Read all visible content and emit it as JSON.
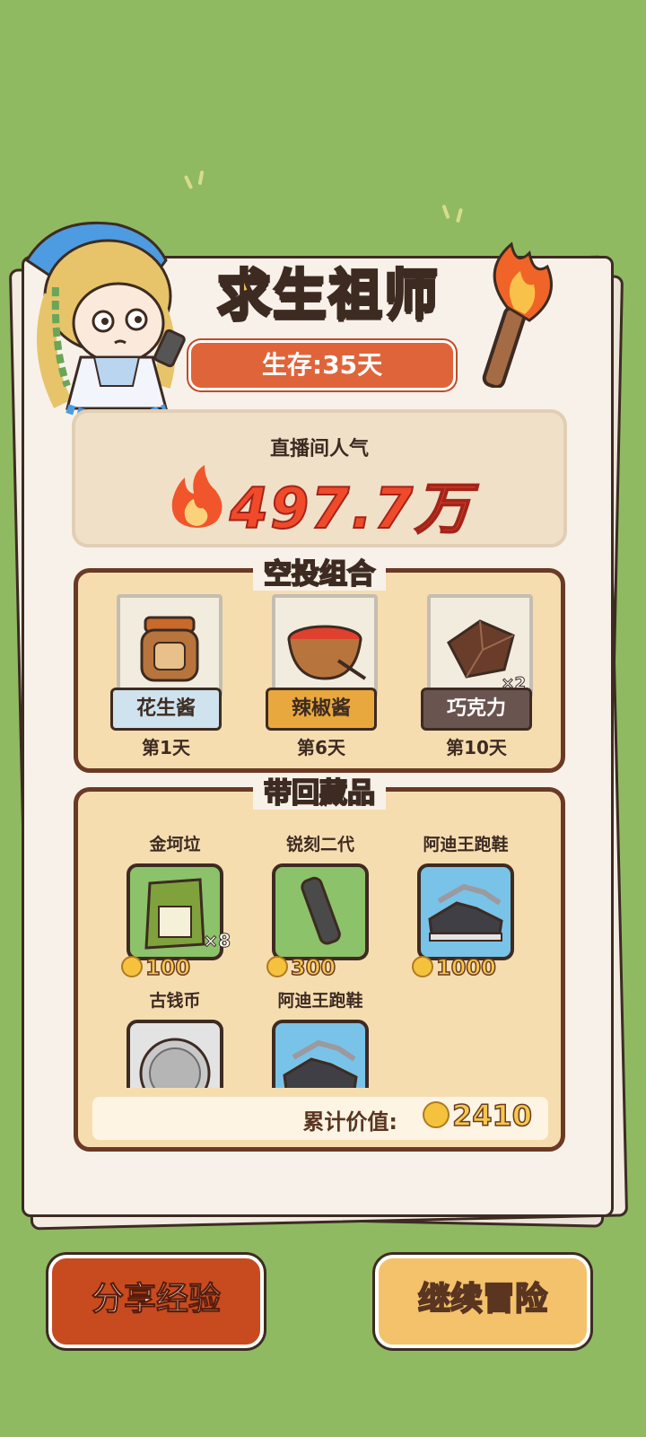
{
  "title": "求生祖师",
  "survival": "生存:35天",
  "popularity": {
    "label": "直播间人气",
    "value": "497.7万",
    "icon": "flame-icon"
  },
  "airdrop": {
    "title": "空投组合",
    "items": [
      {
        "name": "花生酱",
        "day": "第1天",
        "qty": "",
        "label_color": "#cfe3ee",
        "text_color": "#3d2b22"
      },
      {
        "name": "辣椒酱",
        "day": "第6天",
        "qty": "",
        "label_color": "#e9a83d",
        "text_color": "#3d2b22"
      },
      {
        "name": "巧克力",
        "day": "第10天",
        "qty": "×2",
        "label_color": "#6a5450",
        "text_color": "#ffffff"
      }
    ]
  },
  "collection": {
    "title": "带回藏品",
    "items": [
      {
        "name": "金坷垃",
        "price": "100",
        "qty": "×8",
        "bg": "#8cc26a"
      },
      {
        "name": "锐刻二代",
        "price": "300",
        "qty": "",
        "bg": "#8cc26a"
      },
      {
        "name": "阿迪王跑鞋",
        "price": "1000",
        "qty": "",
        "bg": "#79c3e8"
      },
      {
        "name": "古钱币",
        "price": "",
        "qty": "",
        "bg": "#e3e3e3"
      },
      {
        "name": "阿迪王跑鞋",
        "price": "",
        "qty": "",
        "bg": "#79c3e8"
      }
    ],
    "total_label": "累计价值:",
    "total_value": "2410"
  },
  "buttons": {
    "share": "分享经验",
    "continue": "继续冒险"
  }
}
